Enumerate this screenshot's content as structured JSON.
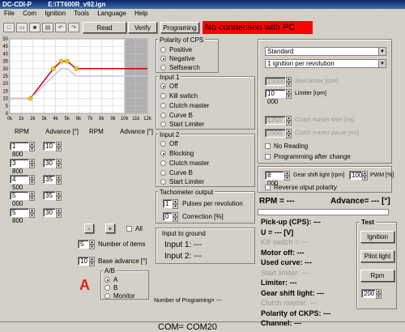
{
  "window": {
    "app": "DC-CDI-P",
    "file": "E:\\TT600R_v92.ign"
  },
  "menu": [
    "File",
    "Com",
    "Ignition",
    "Tools",
    "Language",
    "Help"
  ],
  "toolbar": {
    "read_label": "Read",
    "verify_label": "Verify",
    "programming_label": "Programing"
  },
  "connection_status": "No connection with PC",
  "chart_data": {
    "type": "line",
    "x": [
      0,
      1000,
      2000,
      3000,
      4000,
      5000,
      6000,
      7000,
      8000,
      9000,
      10000,
      11000,
      12000
    ],
    "xtick_labels": [
      "0k",
      "1k",
      "2k",
      "3k",
      "4k",
      "5k",
      "6k",
      "7k",
      "8k",
      "9k",
      "10k",
      "11k",
      "12k"
    ],
    "ytick_labels": [
      "0",
      "5",
      "10",
      "15",
      "20",
      "25",
      "30",
      "35",
      "40",
      "45",
      "50"
    ],
    "ylim": [
      0,
      50
    ],
    "xlim": [
      0,
      12000
    ],
    "grid": true,
    "shaded_from": 10000,
    "series": [
      {
        "color": "#cc0000",
        "x": [
          0,
          1800,
          3800,
          4500,
          5000,
          5800,
          12000
        ],
        "values": [
          10,
          10,
          30,
          35,
          35,
          30,
          30
        ]
      },
      {
        "color": "#c8c0e8",
        "x": [
          0,
          1800,
          3800,
          4500,
          5000,
          5800,
          12000
        ],
        "values": [
          10,
          10,
          25,
          30,
          30,
          25,
          25
        ]
      }
    ],
    "points": [
      [
        1800,
        10
      ],
      [
        3800,
        30
      ],
      [
        4500,
        35
      ],
      [
        5000,
        35
      ],
      [
        5800,
        30
      ]
    ]
  },
  "table": {
    "headers": [
      "RPM",
      "Advance [°]",
      "RPM",
      "Advance [°]"
    ],
    "rows": [
      {
        "rpm": "1 800",
        "adv": "10"
      },
      {
        "rpm": "3 800",
        "adv": "30"
      },
      {
        "rpm": "4 500",
        "adv": "35"
      },
      {
        "rpm": "5 000",
        "adv": "35"
      },
      {
        "rpm": "5 800",
        "adv": "30"
      }
    ]
  },
  "controls": {
    "minus": "-",
    "plus": "+",
    "all_label": "All",
    "num_items_value": "5",
    "num_items_label": "Number of items",
    "base_adv_value": "10",
    "base_adv_label": "Base advance [°]",
    "big_letter": "A",
    "ab_title": "A/B",
    "ab_options": [
      "A",
      "B",
      "Monitor"
    ]
  },
  "polarity": {
    "title": "Polarity of CPS",
    "options": [
      "Positive",
      "Negative",
      "Selfsearch"
    ]
  },
  "input1": {
    "title": "Input 1",
    "options": [
      "Off",
      "Kill switch",
      "Clutch master",
      "Curve B",
      "Start Limiter"
    ]
  },
  "input2": {
    "title": "Input 2",
    "options": [
      "Off",
      "Blocking",
      "Clutch master",
      "Curve B",
      "Start Limiter"
    ]
  },
  "tacho": {
    "title": "Tachometer output",
    "pulses_value": "1",
    "pulses_label": "Pulses per revolution",
    "corr_value": "0",
    "corr_label": "Correction [%]"
  },
  "input_ground": {
    "title": "Input to ground",
    "input1": "Input 1: ---",
    "input2": "Input 2: ---"
  },
  "prog_count": "Number of Programing= ---",
  "com": "COM= COM20",
  "right": {
    "mode": "Standard",
    "ignition": "1 ignition per revolution",
    "start_limiter_value": "15000",
    "start_limiter_label": "Start limiter [rpm]",
    "limiter_value": "10 000",
    "limiter_label": "Limiter [rpm]",
    "clutch_time_value": "1250",
    "clutch_time_label": "Clutch master time [ms]",
    "clutch_pause_value": "2500",
    "clutch_pause_label": "Clutch master pause [ms]",
    "no_reading": "No Reading",
    "prog_after_change": "Programming after change",
    "gear_value": "8 000",
    "gear_label": "Gear shift light [rpm]",
    "pwm_value": "100",
    "pwm_label": "PWM [%]",
    "reverse_label": "Reverse otput polarity"
  },
  "status": {
    "rpm": "RPM = ---",
    "advance": "Advance= --- [°]",
    "pickup": "Pick-up (CPS): ---",
    "u": "U = --- [V]",
    "kill": "Kill switch = ---",
    "motor": "Motor off: ---",
    "curve": "Used curve: ---",
    "start_lim": "Start limiter: ---",
    "limiter": "Limiter: ---",
    "gear": "Gear shift light: ---",
    "clutch": "Clutch master: ---",
    "polarity": "Polarity of CKPS: ---",
    "channel": "Channel: ---"
  },
  "test": {
    "title": "Test",
    "ignition": "Ignition",
    "pilot": "Pilot light",
    "rpm": "Rpm",
    "rpm_value": "200"
  }
}
